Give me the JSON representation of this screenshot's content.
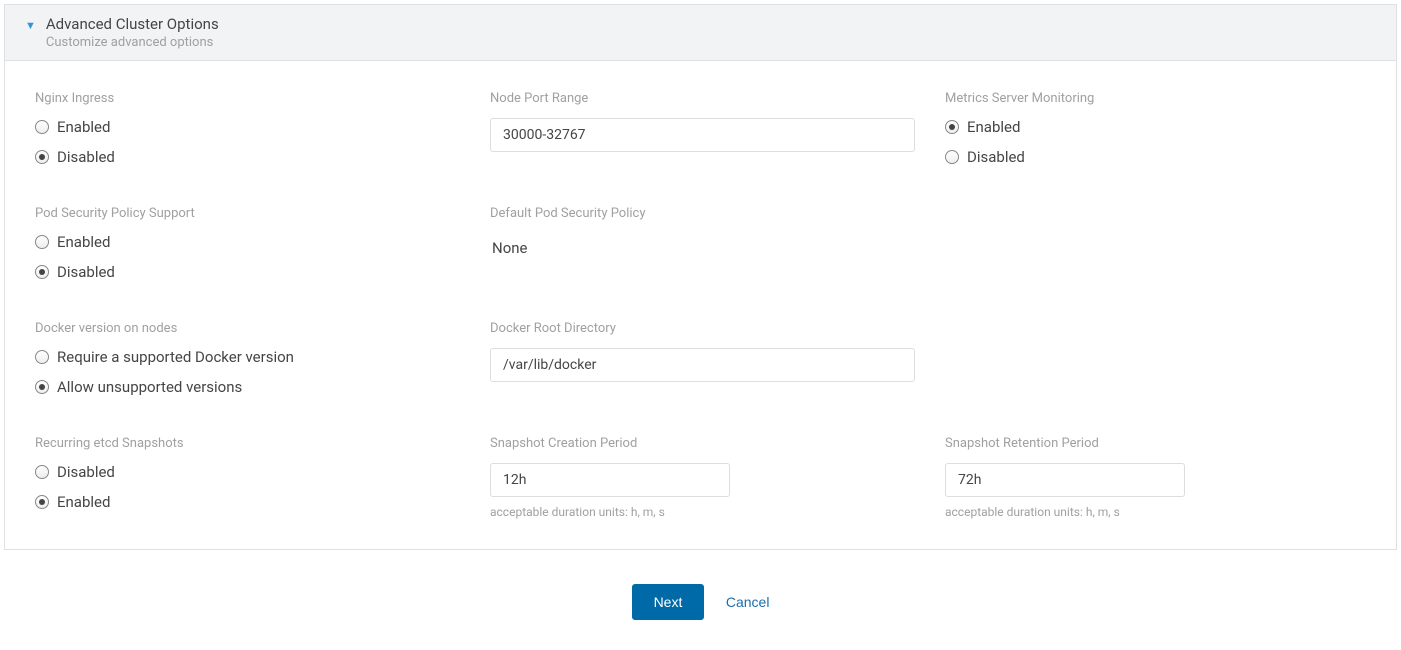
{
  "panel": {
    "title": "Advanced Cluster Options",
    "subtitle": "Customize advanced options"
  },
  "labels": {
    "enabled": "Enabled",
    "disabled": "Disabled"
  },
  "nginx_ingress": {
    "label": "Nginx Ingress",
    "selected": "disabled"
  },
  "node_port_range": {
    "label": "Node Port Range",
    "value": "30000-32767"
  },
  "metrics_server": {
    "label": "Metrics Server Monitoring",
    "selected": "enabled"
  },
  "pod_security_support": {
    "label": "Pod Security Policy Support",
    "selected": "disabled"
  },
  "default_pod_security": {
    "label": "Default Pod Security Policy",
    "value": "None"
  },
  "docker_version": {
    "label": "Docker version on nodes",
    "option_require": "Require a supported Docker version",
    "option_allow": "Allow unsupported versions",
    "selected": "allow"
  },
  "docker_root_dir": {
    "label": "Docker Root Directory",
    "value": "/var/lib/docker"
  },
  "etcd_snapshots": {
    "label": "Recurring etcd Snapshots",
    "selected": "enabled"
  },
  "snapshot_creation": {
    "label": "Snapshot Creation Period",
    "value": "12h",
    "help": "acceptable duration units: h, m, s"
  },
  "snapshot_retention": {
    "label": "Snapshot Retention Period",
    "value": "72h",
    "help": "acceptable duration units: h, m, s"
  },
  "footer": {
    "next": "Next",
    "cancel": "Cancel"
  }
}
